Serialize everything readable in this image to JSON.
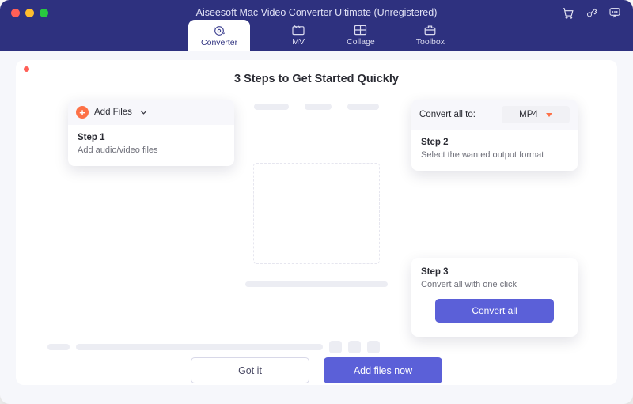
{
  "window_title": "Aiseesoft Mac Video Converter Ultimate (Unregistered)",
  "tabs": {
    "converter": "Converter",
    "mv": "MV",
    "collage": "Collage",
    "toolbox": "Toolbox"
  },
  "heading": "3 Steps to Get Started Quickly",
  "step1": {
    "add_label": "Add Files",
    "title": "Step 1",
    "desc": "Add audio/video files"
  },
  "step2": {
    "prefix": "Convert all to:",
    "format": "MP4",
    "title": "Step 2",
    "desc": "Select the wanted output format"
  },
  "step3": {
    "title": "Step 3",
    "desc": "Convert all with one click",
    "button": "Convert all"
  },
  "actions": {
    "got_it": "Got it",
    "add_now": "Add files now"
  },
  "icons": {
    "cart": "cart-icon",
    "key": "key-icon",
    "chat": "chat-icon"
  }
}
